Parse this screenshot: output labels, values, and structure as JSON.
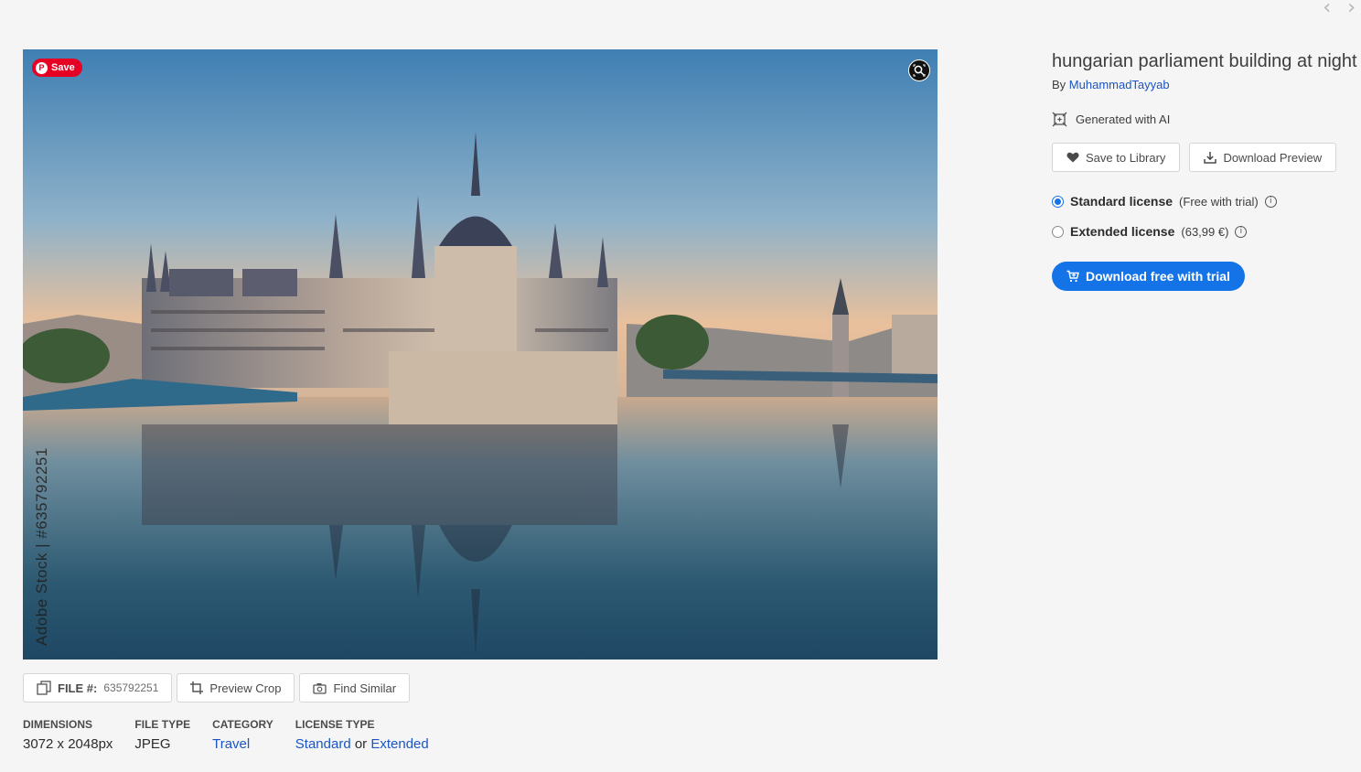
{
  "nav": {
    "prev": "‹",
    "next": "›"
  },
  "image": {
    "pin_save": "Save",
    "watermark_vertical": "Adobe Stock | #635792251"
  },
  "tools": {
    "file_label": "FILE #:",
    "file_number": "635792251",
    "preview_crop": "Preview Crop",
    "find_similar": "Find Similar"
  },
  "meta": {
    "dimensions_label": "DIMENSIONS",
    "dimensions_value": "3072 x 2048px",
    "filetype_label": "FILE TYPE",
    "filetype_value": "JPEG",
    "category_label": "CATEGORY",
    "category_value": "Travel",
    "license_label": "LICENSE TYPE",
    "license_standard": "Standard",
    "license_or": "or",
    "license_extended": "Extended"
  },
  "side": {
    "title": "hungarian parliament building at night",
    "by": "By",
    "author": "MuhammadTayyab",
    "ai_label": "Generated with AI",
    "save_to_library": "Save to Library",
    "download_preview": "Download Preview",
    "standard_license": "Standard license",
    "standard_note": "(Free with trial)",
    "extended_license": "Extended license",
    "extended_price": "(63,99 €)",
    "cta": "Download free with trial"
  },
  "colors": {
    "accent": "#1473e6",
    "link": "#1b55c5",
    "pinterest": "#e60023"
  }
}
